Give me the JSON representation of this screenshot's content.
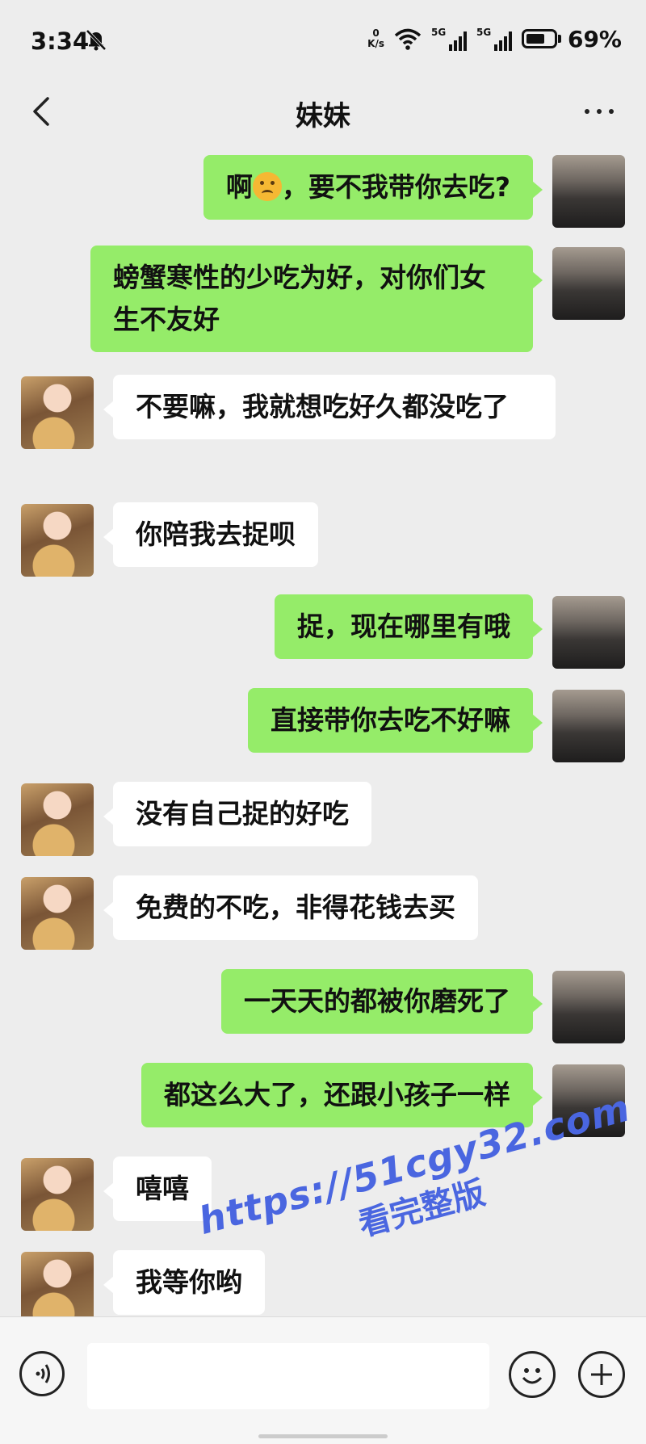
{
  "status_bar": {
    "time": "3:34",
    "net_speed_value": "0",
    "net_speed_unit": "K/s",
    "sim1_label": "5G",
    "sim2_label": "5G",
    "battery_percent": "69%",
    "battery_level": 0.69,
    "icons": [
      "mute-bell-icon",
      "wifi-icon",
      "signal-icon",
      "battery-icon"
    ]
  },
  "header": {
    "back_icon": "chevron-left-icon",
    "title": "妹妹",
    "more_icon": "more-dots-icon"
  },
  "messages": [
    {
      "sender": "me",
      "text_before": "啊",
      "emoji": "frowning-face-emoji",
      "text_after": "，要不我带你去吃?"
    },
    {
      "sender": "me",
      "text": "螃蟹寒性的少吃为好，对你们女生不友好"
    },
    {
      "sender": "her",
      "text": "不要嘛，我就想吃好久都没吃了"
    },
    {
      "sender": "her",
      "text": "你陪我去捉呗"
    },
    {
      "sender": "me",
      "text": "捉，现在哪里有哦"
    },
    {
      "sender": "me",
      "text": "直接带你去吃不好嘛"
    },
    {
      "sender": "her",
      "text": "没有自己捉的好吃"
    },
    {
      "sender": "her",
      "text": "免费的不吃，非得花钱去买"
    },
    {
      "sender": "me",
      "text": "一天天的都被你磨死了"
    },
    {
      "sender": "me",
      "text": "都这么大了，还跟小孩子一样"
    },
    {
      "sender": "her",
      "text": "嘻嘻"
    },
    {
      "sender": "her",
      "text": "我等你哟"
    }
  ],
  "watermark": {
    "url": "https://51cgy32.com",
    "cta": "看完整版"
  },
  "input_bar": {
    "voice_icon": "voice-icon",
    "input_value": "",
    "emoji_icon": "emoji-icon",
    "plus_icon": "plus-icon"
  },
  "colors": {
    "background": "#ededed",
    "my_bubble": "#95ec69",
    "her_bubble": "#ffffff",
    "watermark": "#4a66e0"
  }
}
